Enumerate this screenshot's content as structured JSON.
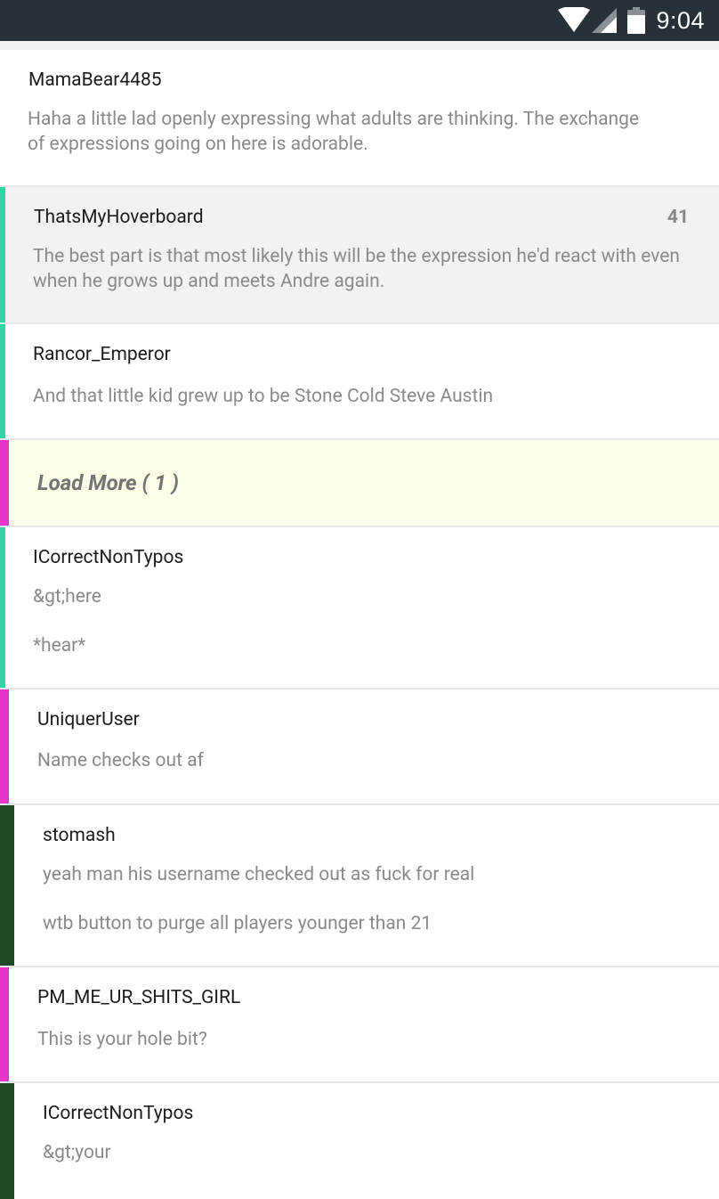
{
  "status_bar": {
    "time": "9:04",
    "icons": [
      "wifi-icon",
      "signal-icon",
      "battery-icon"
    ]
  },
  "colors": {
    "teal": "#2fd6a4",
    "magenta": "#e535c9",
    "dark_green": "#204a27",
    "load_more_bg": "#fdfce8"
  },
  "comments": [
    {
      "author": "MamaBear4485",
      "body": [
        "Haha a little lad openly expressing what adults are thinking. The exchange of expressions going on here is adorable."
      ]
    },
    {
      "author": "ThatsMyHoverboard",
      "score": "41",
      "body": [
        "The best part is that most likely this will be the expression he'd react with even when he grows up and meets Andre again."
      ]
    },
    {
      "author": "Rancor_Emperor",
      "body": [
        "And that little kid grew up to be Stone Cold Steve Austin"
      ]
    },
    {
      "load_more": "Load More ( 1 )"
    },
    {
      "author": "ICorrectNonTypos",
      "body": [
        "&gt;here",
        "*hear*"
      ]
    },
    {
      "author": "UniquerUser",
      "body": [
        "Name checks out af"
      ]
    },
    {
      "author": "stomash",
      "body": [
        "yeah man his username checked out as fuck for real",
        "wtb button to purge all players younger than 21"
      ]
    },
    {
      "author": "PM_ME_UR_SHITS_GIRL",
      "body": [
        "This is your hole bit?"
      ]
    },
    {
      "author": "ICorrectNonTypos",
      "body": [
        "&gt;your"
      ]
    }
  ]
}
